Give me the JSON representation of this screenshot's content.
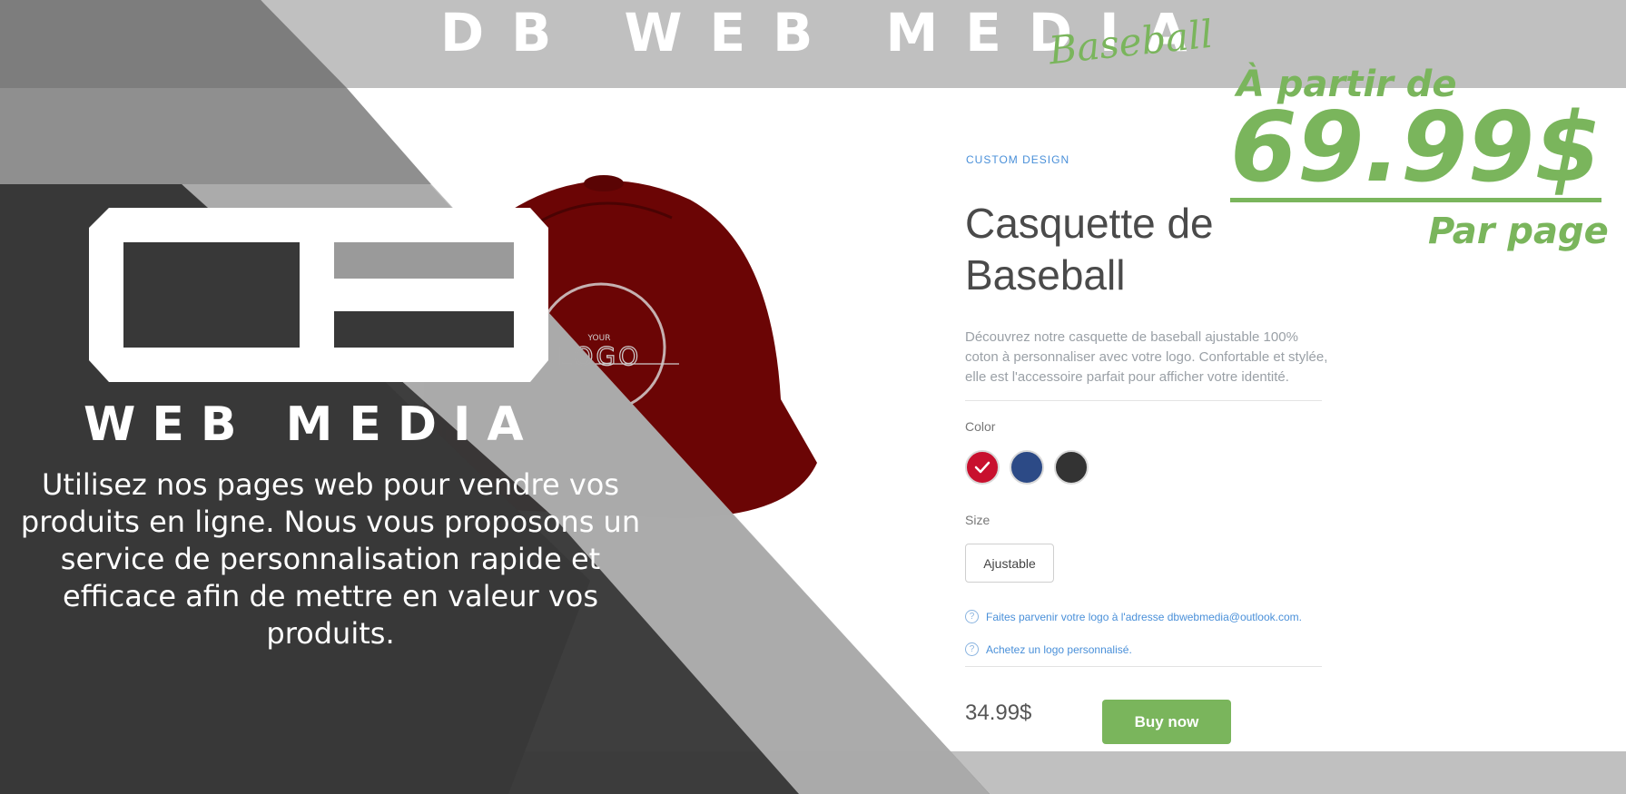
{
  "header": {
    "brand_wordmark": "DB WEB MEDIA",
    "brand_script": "Baseball"
  },
  "hero": {
    "wordmark": "WEB MEDIA",
    "promo_text": "Utilisez nos pages web pour vendre vos produits en ligne. Nous vous proposons un service de personnalisation rapide et efficace afin de mettre en valeur vos produits."
  },
  "product_image": {
    "logo_small": "YOUR",
    "logo_big": "LOGO"
  },
  "product": {
    "tag": "CUSTOM DESIGN",
    "title": "Casquette de Baseball",
    "description": "Découvrez notre casquette de baseball ajustable 100% coton à personnaliser avec votre logo. Confortable et stylée, elle est l'accessoire parfait pour afficher votre identité.",
    "color_label": "Color",
    "colors": [
      {
        "name": "red",
        "hex": "#c8102e",
        "selected": true
      },
      {
        "name": "blue",
        "hex": "#2c4a86",
        "selected": false
      },
      {
        "name": "black",
        "hex": "#333333",
        "selected": false
      }
    ],
    "size_label": "Size",
    "size_option": "Ajustable",
    "help_email": "Faites parvenir votre logo à l'adresse dbwebmedia@outlook.com.",
    "help_buy_logo": "Achetez un logo personnalisé.",
    "price": "34.99$",
    "buy_label": "Buy now",
    "accent_color": "#7ab55c"
  },
  "promo": {
    "from": "À partir de",
    "price": "69.99$",
    "per": "Par page"
  }
}
